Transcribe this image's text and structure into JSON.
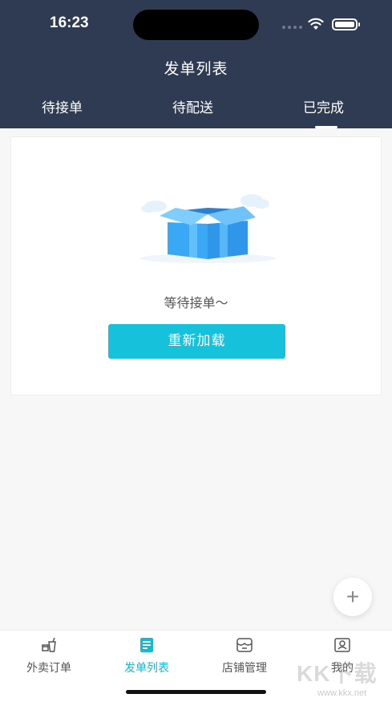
{
  "status_bar": {
    "time": "16:23"
  },
  "header": {
    "title": "发单列表"
  },
  "tabs": [
    {
      "label": "待接单",
      "active": false
    },
    {
      "label": "待配送",
      "active": false
    },
    {
      "label": "已完成",
      "active": true
    }
  ],
  "empty_state": {
    "message": "等待接单～",
    "reload_label": "重新加载"
  },
  "fab": {
    "icon": "plus-icon"
  },
  "bottom_nav": [
    {
      "label": "外卖订单",
      "icon": "takeout-icon",
      "active": false
    },
    {
      "label": "发单列表",
      "icon": "order-list-icon",
      "active": true
    },
    {
      "label": "店铺管理",
      "icon": "store-icon",
      "active": false
    },
    {
      "label": "我的",
      "icon": "profile-icon",
      "active": false
    }
  ],
  "watermark": {
    "text": "KK下载",
    "url": "www.kkx.net"
  },
  "colors": {
    "header_bg": "#2f3b52",
    "accent": "#16c1dc",
    "page_bg": "#f7f7f7"
  }
}
